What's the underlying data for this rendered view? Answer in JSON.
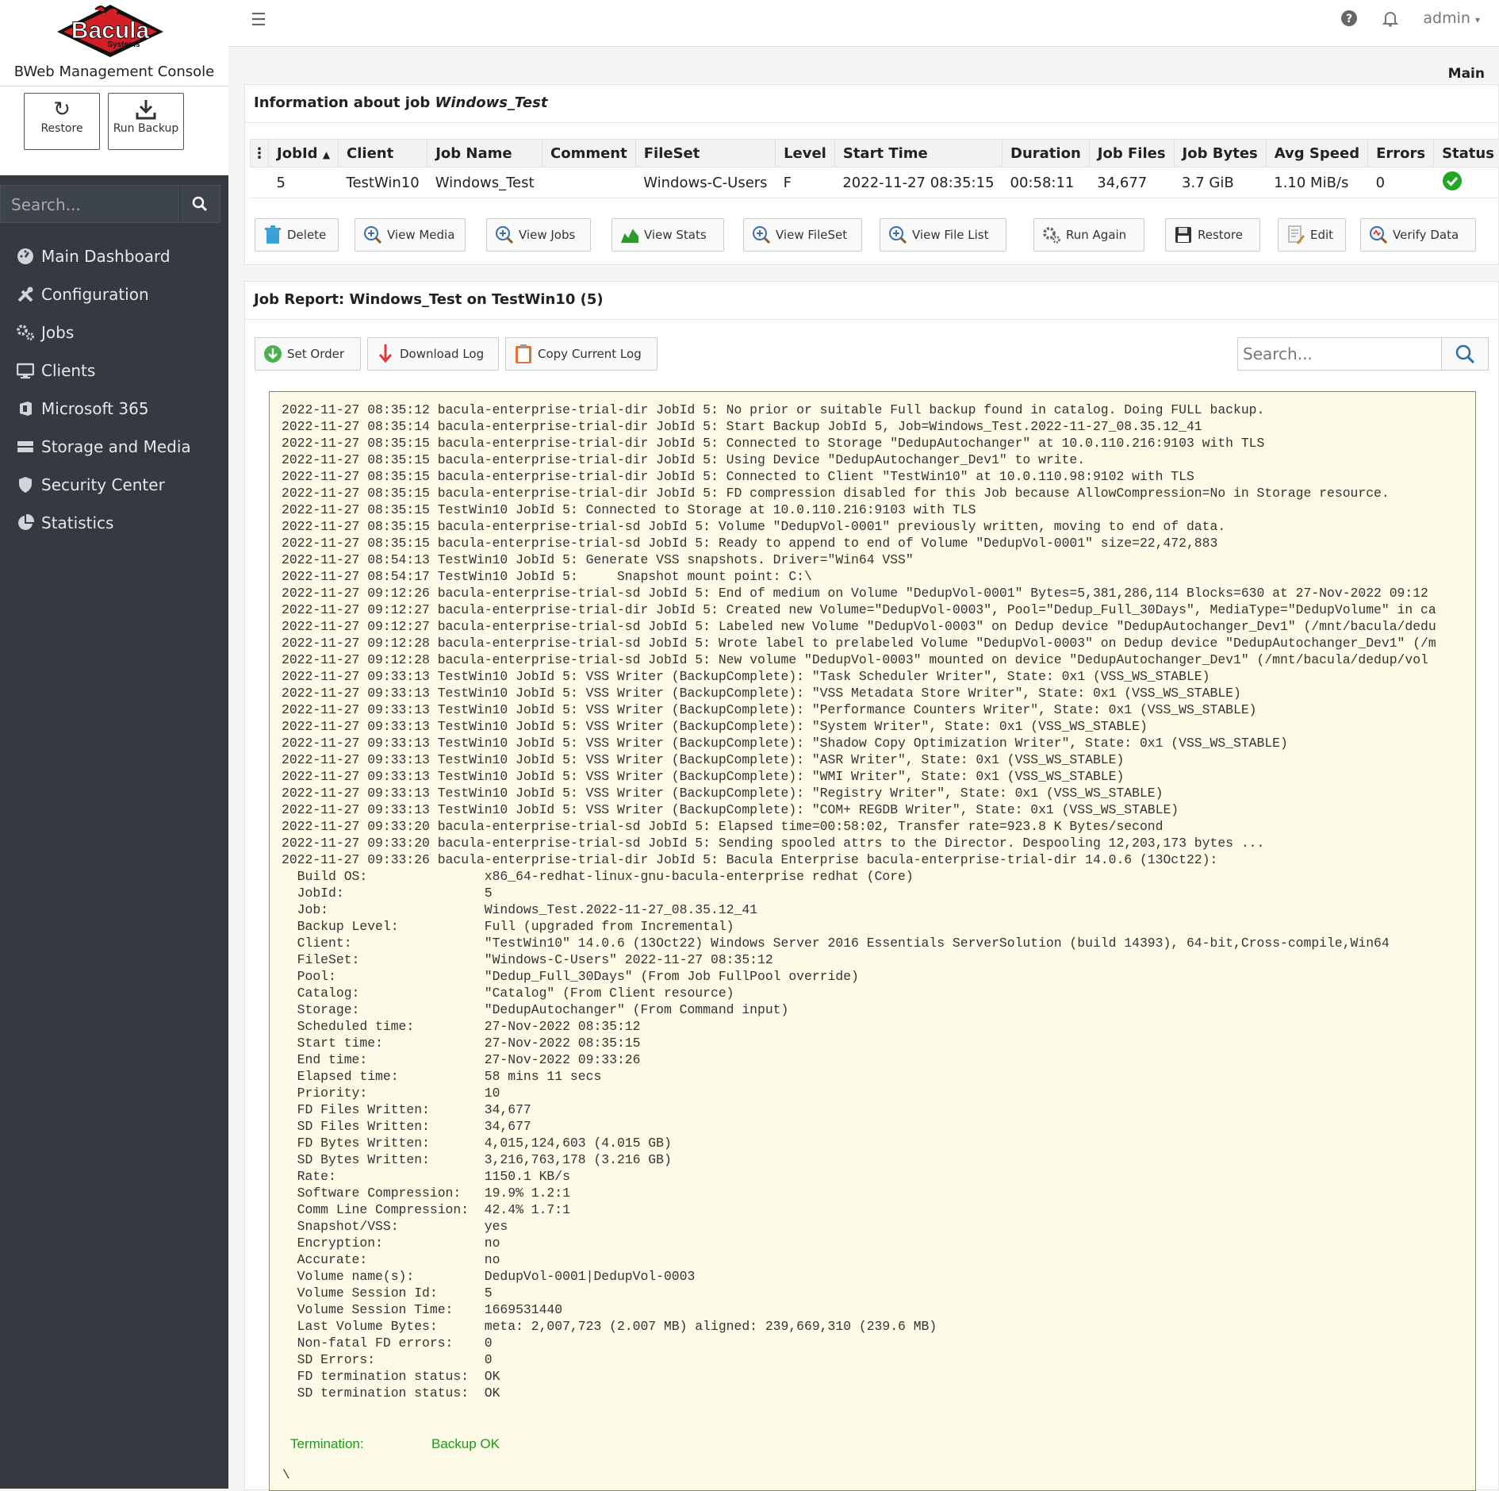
{
  "brand": {
    "logo_text": "Bacula",
    "logo_sub": "Systems",
    "title": "BWeb Management Console"
  },
  "quick_actions": [
    {
      "label": "Restore",
      "icon": "refresh-icon"
    },
    {
      "label": "Run Backup",
      "icon": "download-icon"
    }
  ],
  "sidebar_search": {
    "placeholder": "Search..."
  },
  "nav": [
    {
      "label": "Main Dashboard",
      "icon": "dashboard-icon"
    },
    {
      "label": "Configuration",
      "icon": "tools-icon"
    },
    {
      "label": "Jobs",
      "icon": "gears-icon"
    },
    {
      "label": "Clients",
      "icon": "monitor-icon"
    },
    {
      "label": "Microsoft 365",
      "icon": "office-icon"
    },
    {
      "label": "Storage and Media",
      "icon": "storage-icon"
    },
    {
      "label": "Security Center",
      "icon": "shield-icon"
    },
    {
      "label": "Statistics",
      "icon": "pie-chart-icon"
    }
  ],
  "topbar": {
    "user": "admin"
  },
  "breadcrumb": "Main",
  "job_info": {
    "title_prefix": "Information about job",
    "job_name": "Windows_Test",
    "columns": [
      "JobId",
      "Client",
      "Job Name",
      "Comment",
      "FileSet",
      "Level",
      "Start Time",
      "Duration",
      "Job Files",
      "Job Bytes",
      "Avg Speed",
      "Errors",
      "Status"
    ],
    "row": [
      "5",
      "TestWin10",
      "Windows_Test",
      "",
      "Windows-C-Users",
      "F",
      "2022-11-27 08:35:15",
      "00:58:11",
      "34,677",
      "3.7 GiB",
      "1.10 MiB/s",
      "0",
      "ok"
    ]
  },
  "actions": [
    "Delete",
    "View Media",
    "View Jobs",
    "View Stats",
    "View FileSet",
    "View File List",
    "Run Again",
    "Restore",
    "Edit",
    "Verify Data"
  ],
  "report": {
    "title": "Job Report: Windows_Test on TestWin10 (5)",
    "buttons": [
      "Set Order",
      "Download Log",
      "Copy Current Log"
    ],
    "search_placeholder": "Search...",
    "log": "2022-11-27 08:35:12 bacula-enterprise-trial-dir JobId 5: No prior or suitable Full backup found in catalog. Doing FULL backup.\n2022-11-27 08:35:14 bacula-enterprise-trial-dir JobId 5: Start Backup JobId 5, Job=Windows_Test.2022-11-27_08.35.12_41\n2022-11-27 08:35:15 bacula-enterprise-trial-dir JobId 5: Connected to Storage \"DedupAutochanger\" at 10.0.110.216:9103 with TLS\n2022-11-27 08:35:15 bacula-enterprise-trial-dir JobId 5: Using Device \"DedupAutochanger_Dev1\" to write.\n2022-11-27 08:35:15 bacula-enterprise-trial-dir JobId 5: Connected to Client \"TestWin10\" at 10.0.110.98:9102 with TLS\n2022-11-27 08:35:15 bacula-enterprise-trial-dir JobId 5: FD compression disabled for this Job because AllowCompression=No in Storage resource.\n2022-11-27 08:35:15 TestWin10 JobId 5: Connected to Storage at 10.0.110.216:9103 with TLS\n2022-11-27 08:35:15 bacula-enterprise-trial-sd JobId 5: Volume \"DedupVol-0001\" previously written, moving to end of data.\n2022-11-27 08:35:15 bacula-enterprise-trial-sd JobId 5: Ready to append to end of Volume \"DedupVol-0001\" size=22,472,883\n2022-11-27 08:54:13 TestWin10 JobId 5: Generate VSS snapshots. Driver=\"Win64 VSS\"\n2022-11-27 08:54:17 TestWin10 JobId 5:     Snapshot mount point: C:\\\n2022-11-27 09:12:26 bacula-enterprise-trial-sd JobId 5: End of medium on Volume \"DedupVol-0001\" Bytes=5,381,286,114 Blocks=630 at 27-Nov-2022 09:12\n2022-11-27 09:12:27 bacula-enterprise-trial-dir JobId 5: Created new Volume=\"DedupVol-0003\", Pool=\"Dedup_Full_30Days\", MediaType=\"DedupVolume\" in ca\n2022-11-27 09:12:27 bacula-enterprise-trial-sd JobId 5: Labeled new Volume \"DedupVol-0003\" on Dedup device \"DedupAutochanger_Dev1\" (/mnt/bacula/dedu\n2022-11-27 09:12:28 bacula-enterprise-trial-sd JobId 5: Wrote label to prelabeled Volume \"DedupVol-0003\" on Dedup device \"DedupAutochanger_Dev1\" (/m\n2022-11-27 09:12:28 bacula-enterprise-trial-sd JobId 5: New volume \"DedupVol-0003\" mounted on device \"DedupAutochanger_Dev1\" (/mnt/bacula/dedup/vol\n2022-11-27 09:33:13 TestWin10 JobId 5: VSS Writer (BackupComplete): \"Task Scheduler Writer\", State: 0x1 (VSS_WS_STABLE)\n2022-11-27 09:33:13 TestWin10 JobId 5: VSS Writer (BackupComplete): \"VSS Metadata Store Writer\", State: 0x1 (VSS_WS_STABLE)\n2022-11-27 09:33:13 TestWin10 JobId 5: VSS Writer (BackupComplete): \"Performance Counters Writer\", State: 0x1 (VSS_WS_STABLE)\n2022-11-27 09:33:13 TestWin10 JobId 5: VSS Writer (BackupComplete): \"System Writer\", State: 0x1 (VSS_WS_STABLE)\n2022-11-27 09:33:13 TestWin10 JobId 5: VSS Writer (BackupComplete): \"Shadow Copy Optimization Writer\", State: 0x1 (VSS_WS_STABLE)\n2022-11-27 09:33:13 TestWin10 JobId 5: VSS Writer (BackupComplete): \"ASR Writer\", State: 0x1 (VSS_WS_STABLE)\n2022-11-27 09:33:13 TestWin10 JobId 5: VSS Writer (BackupComplete): \"WMI Writer\", State: 0x1 (VSS_WS_STABLE)\n2022-11-27 09:33:13 TestWin10 JobId 5: VSS Writer (BackupComplete): \"Registry Writer\", State: 0x1 (VSS_WS_STABLE)\n2022-11-27 09:33:13 TestWin10 JobId 5: VSS Writer (BackupComplete): \"COM+ REGDB Writer\", State: 0x1 (VSS_WS_STABLE)\n2022-11-27 09:33:20 bacula-enterprise-trial-sd JobId 5: Elapsed time=00:58:02, Transfer rate=923.8 K Bytes/second\n2022-11-27 09:33:20 bacula-enterprise-trial-sd JobId 5: Sending spooled attrs to the Director. Despooling 12,203,173 bytes ...\n2022-11-27 09:33:26 bacula-enterprise-trial-dir JobId 5: Bacula Enterprise bacula-enterprise-trial-dir 14.0.6 (13Oct22):\n  Build OS:               x86_64-redhat-linux-gnu-bacula-enterprise redhat (Core)\n  JobId:                  5\n  Job:                    Windows_Test.2022-11-27_08.35.12_41\n  Backup Level:           Full (upgraded from Incremental)\n  Client:                 \"TestWin10\" 14.0.6 (13Oct22) Windows Server 2016 Essentials ServerSolution (build 14393), 64-bit,Cross-compile,Win64\n  FileSet:                \"Windows-C-Users\" 2022-11-27 08:35:12\n  Pool:                   \"Dedup_Full_30Days\" (From Job FullPool override)\n  Catalog:                \"Catalog\" (From Client resource)\n  Storage:                \"DedupAutochanger\" (From Command input)\n  Scheduled time:         27-Nov-2022 08:35:12\n  Start time:             27-Nov-2022 08:35:15\n  End time:               27-Nov-2022 09:33:26\n  Elapsed time:           58 mins 11 secs\n  Priority:               10\n  FD Files Written:       34,677\n  SD Files Written:       34,677\n  FD Bytes Written:       4,015,124,603 (4.015 GB)\n  SD Bytes Written:       3,216,763,178 (3.216 GB)\n  Rate:                   1150.1 KB/s\n  Software Compression:   19.9% 1.2:1\n  Comm Line Compression:  42.4% 1.7:1\n  Snapshot/VSS:           yes\n  Encryption:             no\n  Accurate:               no\n  Volume name(s):         DedupVol-0001|DedupVol-0003\n  Volume Session Id:      5\n  Volume Session Time:    1669531440\n  Last Volume Bytes:      meta: 2,007,723 (2.007 MB) aligned: 239,669,310 (239.6 MB)\n  Non-fatal FD errors:    0\n  SD Errors:              0\n  FD termination status:  OK\n  SD termination status:  OK",
    "termination_label": "Termination:",
    "termination_value": "Backup OK",
    "trailing": "\\"
  },
  "colors": {
    "sidebar_bg": "#343a40",
    "log_bg": "#fdfbe8",
    "ok_green": "#1a9a1a",
    "brand_red": "#d51f26"
  }
}
